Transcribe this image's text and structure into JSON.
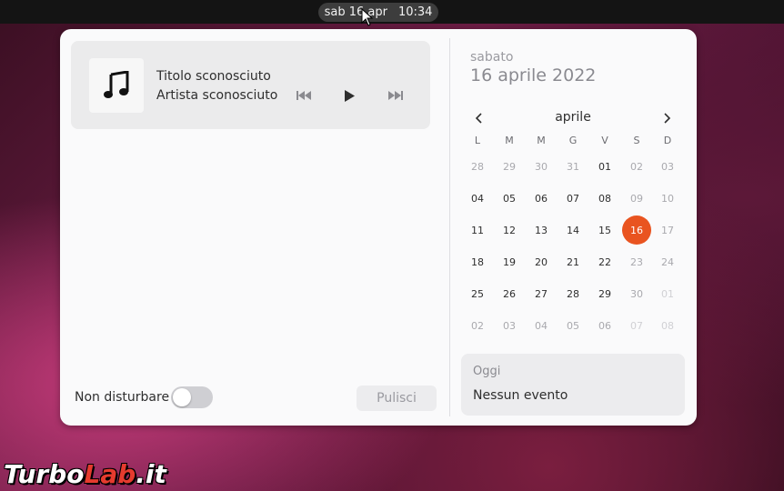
{
  "topbar": {
    "date": "sab 16 apr",
    "time": "10:34"
  },
  "media": {
    "album_icon": "music-note-icon",
    "title": "Titolo sconosciuto",
    "artist": "Artista sconosciuto",
    "controls": [
      "previous-track-icon",
      "play-icon",
      "next-track-icon"
    ]
  },
  "notifications": {
    "dnd_label": "Non disturbare",
    "dnd_enabled": false,
    "clear_label": "Pulisci"
  },
  "calendar": {
    "weekday": "sabato",
    "full_date": "16 aprile 2022",
    "month": "aprile",
    "day_headers": [
      "L",
      "M",
      "M",
      "G",
      "V",
      "S",
      "D"
    ],
    "weeks": [
      [
        "28",
        "29",
        "30",
        "31",
        "01",
        "02",
        "03"
      ],
      [
        "04",
        "05",
        "06",
        "07",
        "08",
        "09",
        "10"
      ],
      [
        "11",
        "12",
        "13",
        "14",
        "15",
        "16",
        "17"
      ],
      [
        "18",
        "19",
        "20",
        "21",
        "22",
        "23",
        "24"
      ],
      [
        "25",
        "26",
        "27",
        "28",
        "29",
        "30",
        "01"
      ],
      [
        "02",
        "03",
        "04",
        "05",
        "06",
        "07",
        "08"
      ]
    ],
    "today": "16",
    "accent_color": "#e95420"
  },
  "events": {
    "title": "Oggi",
    "empty": "Nessun evento"
  },
  "watermark": {
    "part1": "Turbo",
    "part2": "Lab",
    "part3": ".it"
  }
}
